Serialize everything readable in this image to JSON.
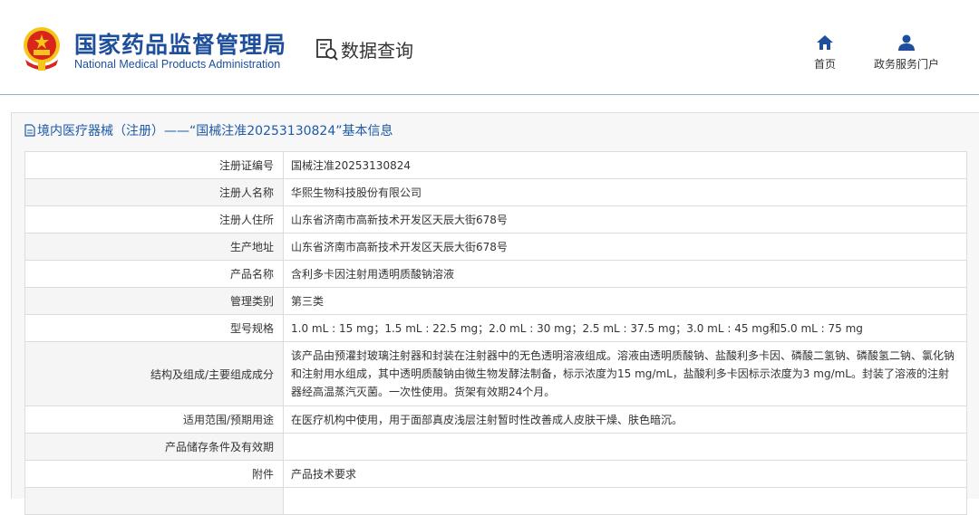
{
  "header": {
    "site_title_cn": "国家药品监督管理局",
    "site_title_en": "National Medical Products Administration",
    "query_label": "数据查询",
    "nav": [
      {
        "label": "首页",
        "icon": "home-icon"
      },
      {
        "label": "政务服务门户",
        "icon": "user-icon"
      }
    ]
  },
  "panel": {
    "title": "境内医疗器械（注册）——“国械注准20253130824”基本信息"
  },
  "rows": [
    {
      "label": "注册证编号",
      "value": "国械注准20253130824"
    },
    {
      "label": "注册人名称",
      "value": "华熙生物科技股份有限公司"
    },
    {
      "label": "注册人住所",
      "value": "山东省济南市高新技术开发区天辰大街678号"
    },
    {
      "label": "生产地址",
      "value": "山东省济南市高新技术开发区天辰大街678号"
    },
    {
      "label": "产品名称",
      "value": "含利多卡因注射用透明质酸钠溶液"
    },
    {
      "label": "管理类别",
      "value": "第三类"
    },
    {
      "label": "型号规格",
      "value": "1.0 mL : 15 mg；1.5 mL : 22.5 mg；2.0 mL : 30 mg；2.5 mL : 37.5 mg；3.0 mL : 45 mg和5.0 mL : 75 mg"
    },
    {
      "label": "结构及组成/主要组成成分",
      "value": "该产品由预灌封玻璃注射器和封装在注射器中的无色透明溶液组成。溶液由透明质酸钠、盐酸利多卡因、磷酸二氢钠、磷酸氢二钠、氯化钠和注射用水组成，其中透明质酸钠由微生物发酵法制备，标示浓度为15 mg/mL，盐酸利多卡因标示浓度为3 mg/mL。封装了溶液的注射器经高温蒸汽灭菌。一次性使用。货架有效期24个月。"
    },
    {
      "label": "适用范围/预期用途",
      "value": "在医疗机构中使用，用于面部真皮浅层注射暂时性改善成人皮肤干燥、肤色暗沉。"
    },
    {
      "label": "产品储存条件及有效期",
      "value": ""
    },
    {
      "label": "附件",
      "value": "产品技术要求"
    }
  ],
  "colors": {
    "brand_blue": "#1d4f9c",
    "link_blue": "#1d5aa8",
    "emblem_red": "#d8261c",
    "emblem_gold": "#f5c518"
  }
}
